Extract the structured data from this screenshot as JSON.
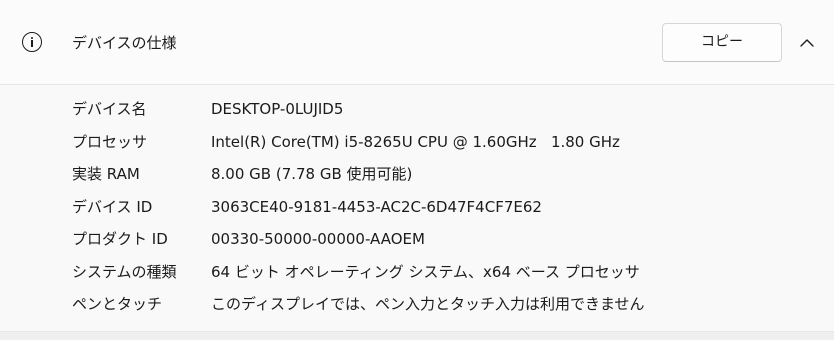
{
  "section": {
    "title": "デバイスの仕様",
    "icon": "info-icon",
    "copy_label": "コピー",
    "collapse_icon": "chevron-up-icon"
  },
  "specs": [
    {
      "label": "デバイス名",
      "value": "DESKTOP-0LUJID5"
    },
    {
      "label": "プロセッサ",
      "value": "Intel(R) Core(TM) i5-8265U CPU @ 1.60GHz   1.80 GHz"
    },
    {
      "label": "実装 RAM",
      "value": "8.00 GB (7.78 GB 使用可能)"
    },
    {
      "label": "デバイス ID",
      "value": "3063CE40-9181-4453-AC2C-6D47F4CF7E62"
    },
    {
      "label": "プロダクト ID",
      "value": "00330-50000-00000-AAOEM"
    },
    {
      "label": "システムの種類",
      "value": "64 ビット オペレーティング システム、x64 ベース プロセッサ"
    },
    {
      "label": "ペンとタッチ",
      "value": "このディスプレイでは、ペン入力とタッチ入力は利用できません"
    }
  ]
}
